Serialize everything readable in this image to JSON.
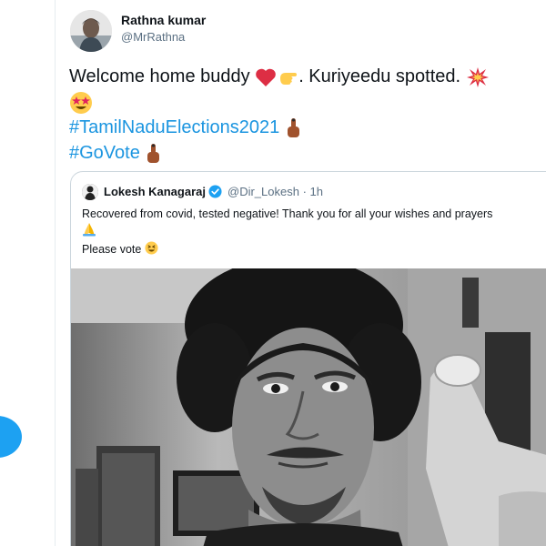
{
  "tweet": {
    "author_name": "Rathna kumar",
    "author_handle": "@MrRathna",
    "text_line1": "Welcome home buddy",
    "text_line1b": ". Kuriyeedu spotted.",
    "hashtag1": "#TamilNaduElections2021",
    "hashtag2": "#GoVote"
  },
  "quoted_tweet": {
    "author_name": "Lokesh Kanagaraj",
    "author_handle": "@Dir_Lokesh",
    "separator": "·",
    "time": "1h",
    "text_line1": "Recovered from covid, tested negative! Thank you for all your wishes and prayers",
    "text_line2": "Please vote"
  },
  "icons": {
    "heart": "red-heart-emoji",
    "hand": "hand-emoji",
    "collision": "collision-emoji",
    "star_eyes": "star-struck-emoji",
    "inked_finger": "index-finger-emoji",
    "pray": "folded-hands-emoji",
    "grin": "grinning-emoji",
    "verified": "verified-badge-icon"
  },
  "colors": {
    "accent": "#1da1f2",
    "hashtag": "#1b95e0",
    "border": "#ccd6dd",
    "secondary_text": "#5b7083"
  }
}
